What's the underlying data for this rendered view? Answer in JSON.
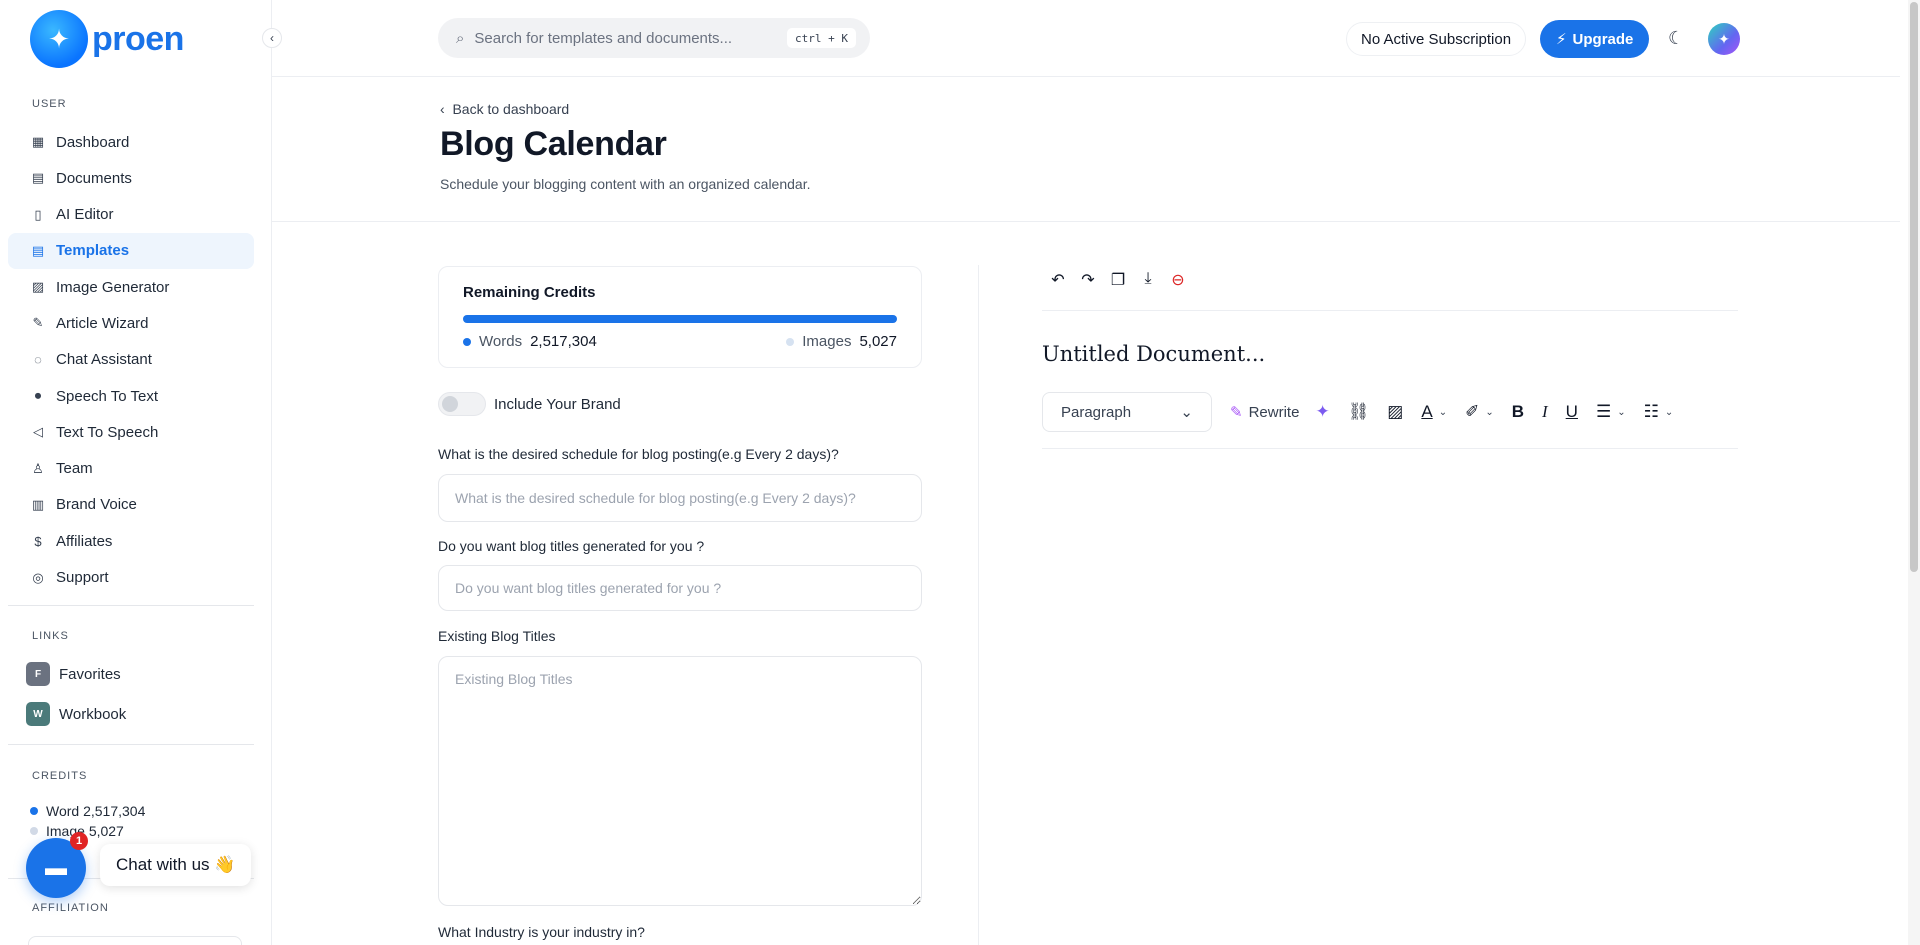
{
  "brand": {
    "name": "proen"
  },
  "sidebar": {
    "user_label": "USER",
    "items": [
      {
        "label": "Dashboard",
        "icon": "grid-icon"
      },
      {
        "label": "Documents",
        "icon": "archive-icon"
      },
      {
        "label": "AI Editor",
        "icon": "book-icon"
      },
      {
        "label": "Templates",
        "icon": "file-text-icon"
      },
      {
        "label": "Image Generator",
        "icon": "image-icon"
      },
      {
        "label": "Article Wizard",
        "icon": "file-edit-icon"
      },
      {
        "label": "Chat Assistant",
        "icon": "message-circle-icon"
      },
      {
        "label": "Speech To Text",
        "icon": "mic-icon"
      },
      {
        "label": "Text To Speech",
        "icon": "speaker-icon"
      },
      {
        "label": "Team",
        "icon": "user-plus-icon"
      },
      {
        "label": "Brand Voice",
        "icon": "layout-icon"
      },
      {
        "label": "Affiliates",
        "icon": "dollar-icon"
      },
      {
        "label": "Support",
        "icon": "lifebuoy-icon"
      }
    ],
    "active_item": "Templates",
    "links_label": "LINKS",
    "links": [
      {
        "badge": "F",
        "label": "Favorites",
        "color": "#6b7280"
      },
      {
        "badge": "W",
        "label": "Workbook",
        "color": "#4b7a7a"
      }
    ],
    "credits_label": "CREDITS",
    "credits": {
      "word_label": "Word",
      "word_value": "2,517,304",
      "image_label": "Image",
      "image_value": "5,027"
    },
    "affiliation_label": "AFFILIATION"
  },
  "chat": {
    "badge_count": "1",
    "bubble_text": "Chat with us 👋"
  },
  "topbar": {
    "search_placeholder": "Search for templates and documents...",
    "search_shortcut": "ctrl + K",
    "subscription_text": "No Active Subscription",
    "upgrade_label": "Upgrade"
  },
  "header": {
    "back_label": "Back to dashboard",
    "title": "Blog Calendar",
    "subtitle": "Schedule your blogging content with an organized calendar."
  },
  "form": {
    "credits_title": "Remaining Credits",
    "words_label": "Words",
    "words_value": "2,517,304",
    "images_label": "Images",
    "images_value": "5,027",
    "brand_toggle_label": "Include Your Brand",
    "fields": [
      {
        "label": "What is the desired schedule for blog posting(e.g Every 2 days)?",
        "placeholder": "What is the desired schedule for blog posting(e.g Every 2 days)?",
        "value": ""
      },
      {
        "label": "Do you want blog titles generated for you ?",
        "placeholder": "Do you want blog titles generated for you ?",
        "value": ""
      },
      {
        "label": "Existing Blog Titles",
        "placeholder": "Existing Blog Titles",
        "value": ""
      },
      {
        "label": "What Industry is your industry in?"
      }
    ]
  },
  "editor": {
    "doc_title": "Untitled Document...",
    "paragraph_select": "Paragraph",
    "rewrite_label": "Rewrite"
  },
  "colors": {
    "accent": "#1a73e8",
    "active_bg": "#eef5fd",
    "danger": "#dc2626"
  }
}
